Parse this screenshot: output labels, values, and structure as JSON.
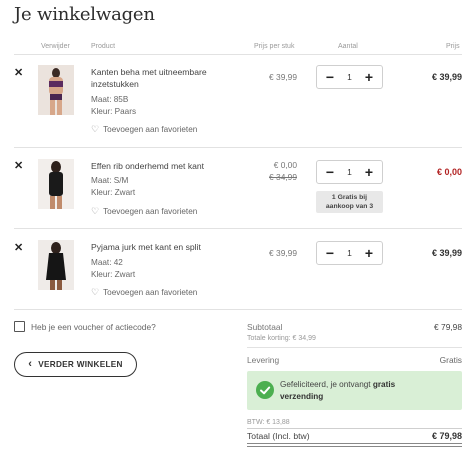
{
  "page": {
    "title": "Je winkelwagen"
  },
  "columns": {
    "remove": "Verwijder",
    "product": "Product",
    "unit_price": "Prijs per stuk",
    "quantity": "Aantal",
    "total": "Prijs"
  },
  "items": [
    {
      "name_line1": "Kanten beha met uitneembare",
      "name_line2": "inzetstukken",
      "size": "Maat: 85B",
      "color": "Kleur: Paars",
      "favorite": "Toevoegen aan favorieten",
      "unit_price": "€ 39,99",
      "qty": "1",
      "total": "€ 39,99"
    },
    {
      "name_line1": "Effen rib onderhemd met kant",
      "size": "Maat: S/M",
      "color": "Kleur: Zwart",
      "favorite": "Toevoegen aan favorieten",
      "unit_price": "€ 0,00",
      "unit_price_old": "€ 34,99",
      "qty": "1",
      "promo_line1": "1 Gratis bij",
      "promo_line2": "aankoop van 3",
      "total": "€ 0,00"
    },
    {
      "name_line1": "Pyjama jurk met kant en split",
      "size": "Maat: 42",
      "color": "Kleur: Zwart",
      "favorite": "Toevoegen aan favorieten",
      "unit_price": "€ 39,99",
      "qty": "1",
      "total": "€ 39,99"
    }
  ],
  "voucher": {
    "label": "Heb je een voucher of actiecode?"
  },
  "continue_button": {
    "label": "VERDER WINKELEN"
  },
  "summary": {
    "subtotal_label": "Subtotaal",
    "subtotal_value": "€ 79,98",
    "discount_text": "Totale korting: € 34,99",
    "delivery_label": "Levering",
    "delivery_value": "Gratis",
    "success_prefix": "Gefeliciteerd, je ontvangt",
    "success_bold_1": "gratis",
    "success_bold_2": "verzending",
    "vat_text": "BTW: € 13,88",
    "total_label": "Totaal (Incl. btw)",
    "total_value": "€ 79,98"
  },
  "colors": {
    "discount_red": "#b22222",
    "success_bg": "#d9efd6",
    "success_icon": "#4caf50"
  },
  "icons": [
    "close-icon",
    "heart-icon",
    "minus-icon",
    "plus-icon",
    "chevron-left-icon",
    "checkmark-circle-icon"
  ]
}
